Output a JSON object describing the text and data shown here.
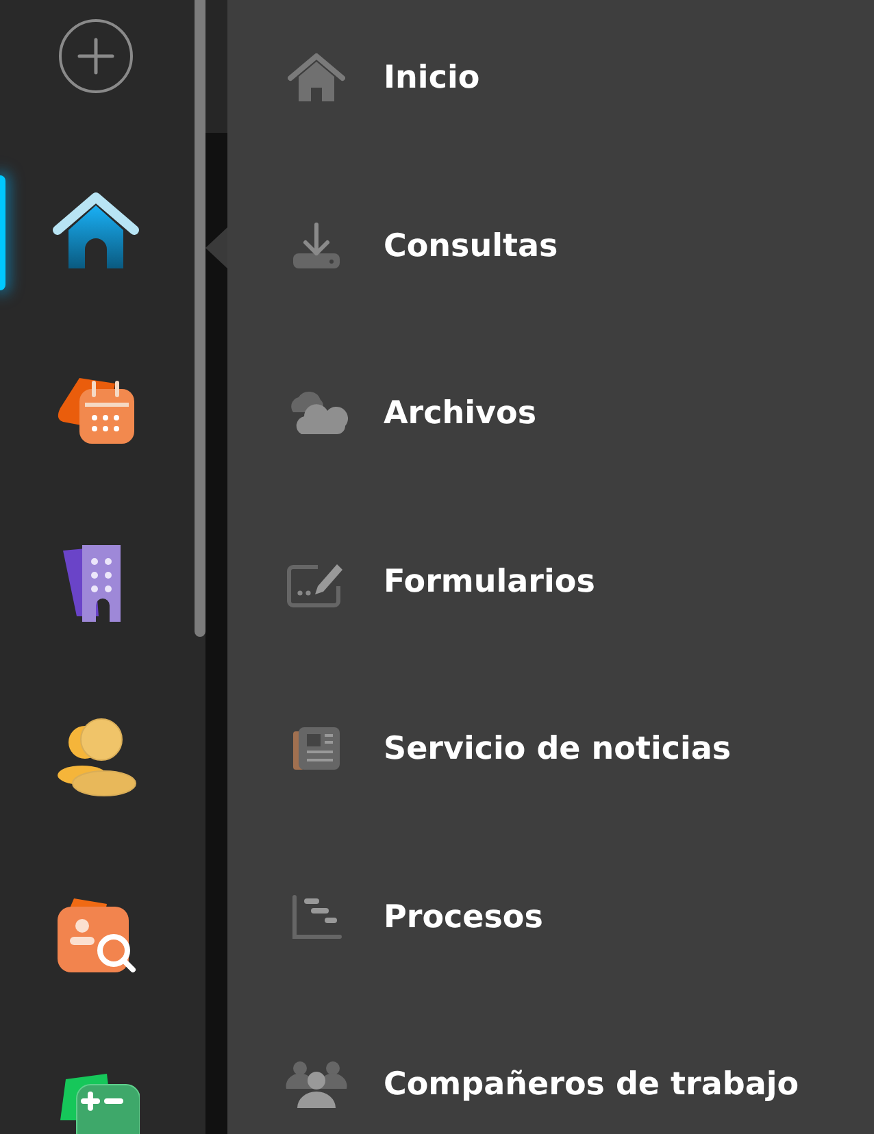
{
  "rail": {
    "items": [
      {
        "kind": "home",
        "selected": true
      },
      {
        "kind": "calendar",
        "selected": false
      },
      {
        "kind": "building",
        "selected": false
      },
      {
        "kind": "coins",
        "selected": false
      },
      {
        "kind": "person-search",
        "selected": false
      },
      {
        "kind": "calculator",
        "selected": false
      }
    ]
  },
  "menu": {
    "items": [
      {
        "kind": "home",
        "label": "Inicio"
      },
      {
        "kind": "download",
        "label": "Consultas"
      },
      {
        "kind": "cloud",
        "label": "Archivos"
      },
      {
        "kind": "form",
        "label": "Formularios"
      },
      {
        "kind": "news",
        "label": "Servicio de noticias"
      },
      {
        "kind": "gantt",
        "label": "Procesos"
      },
      {
        "kind": "team",
        "label": "Compañeros de trabajo"
      }
    ]
  }
}
